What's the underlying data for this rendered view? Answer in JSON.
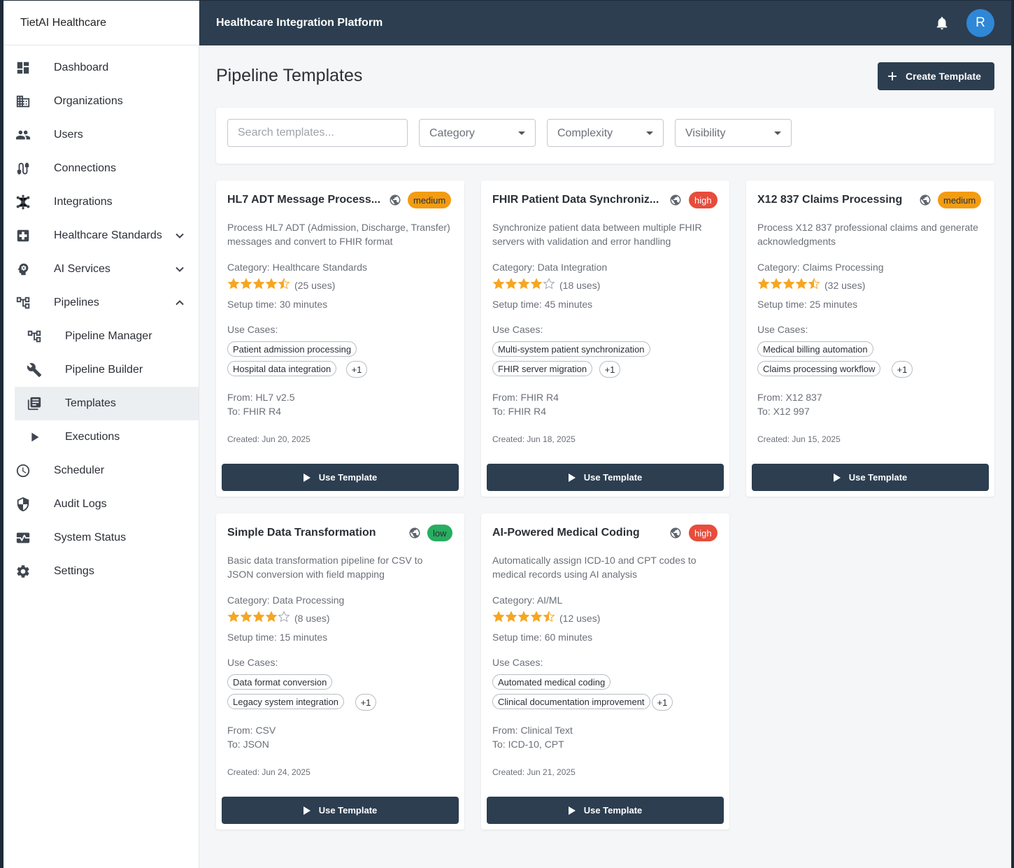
{
  "app": {
    "brand": "TietAI Healthcare",
    "topbar_title": "Healthcare Integration Platform",
    "avatar_initial": "R"
  },
  "sidebar": {
    "items": [
      {
        "label": "Dashboard",
        "icon": "dashboard-icon"
      },
      {
        "label": "Organizations",
        "icon": "building-icon"
      },
      {
        "label": "Users",
        "icon": "people-icon"
      },
      {
        "label": "Connections",
        "icon": "cable-icon"
      },
      {
        "label": "Integrations",
        "icon": "hub-icon"
      },
      {
        "label": "Healthcare Standards",
        "icon": "medical-plus-icon",
        "expanded": false
      },
      {
        "label": "AI Services",
        "icon": "brain-icon",
        "expanded": false
      },
      {
        "label": "Pipelines",
        "icon": "pipeline-icon",
        "expanded": true
      },
      {
        "label": "Pipeline Manager",
        "icon": "pipeline-icon",
        "sub": true
      },
      {
        "label": "Pipeline Builder",
        "icon": "wrench-icon",
        "sub": true
      },
      {
        "label": "Templates",
        "icon": "library-books-icon",
        "sub": true,
        "active": true
      },
      {
        "label": "Executions",
        "icon": "play-icon",
        "sub": true
      },
      {
        "label": "Scheduler",
        "icon": "clock-icon"
      },
      {
        "label": "Audit Logs",
        "icon": "shield-icon"
      },
      {
        "label": "System Status",
        "icon": "monitor-heart-icon"
      },
      {
        "label": "Settings",
        "icon": "gear-icon"
      }
    ]
  },
  "page": {
    "title": "Pipeline Templates",
    "create_label": "Create Template"
  },
  "filters": {
    "search_placeholder": "Search templates...",
    "category": "Category",
    "complexity": "Complexity",
    "visibility": "Visibility"
  },
  "colors": {
    "primary": "#2c3e50",
    "star": "#f5a623",
    "medium": "#f39c12",
    "high": "#e74c3c",
    "low": "#27ae60",
    "avatar": "#2f87d6"
  },
  "templates": [
    {
      "title": "HL7 ADT Message Process...",
      "complexity": "medium",
      "description": "Process HL7 ADT (Admission, Discharge, Transfer) messages and convert to FHIR format",
      "category": "Category: Healthcare Standards",
      "rating": 4.5,
      "uses": "(25 uses)",
      "setup": "Setup time: 30 minutes",
      "use_cases_label": "Use Cases:",
      "use_cases": [
        "Patient admission processing",
        "Hospital data integration"
      ],
      "more": "+1",
      "from": "From: HL7 v2.5",
      "to": "To: FHIR R4",
      "created": "Created: Jun 20, 2025",
      "button": "Use Template"
    },
    {
      "title": "FHIR Patient Data Synchroniz...",
      "complexity": "high",
      "description": "Synchronize patient data between multiple FHIR servers with validation and error handling",
      "category": "Category: Data Integration",
      "rating": 4,
      "uses": "(18 uses)",
      "setup": "Setup time: 45 minutes",
      "use_cases_label": "Use Cases:",
      "use_cases": [
        "Multi-system patient synchronization",
        "FHIR server migration"
      ],
      "more": "+1",
      "from": "From: FHIR R4",
      "to": "To: FHIR R4",
      "created": "Created: Jun 18, 2025",
      "button": "Use Template"
    },
    {
      "title": "X12 837 Claims Processing",
      "complexity": "medium",
      "description": "Process X12 837 professional claims and generate acknowledgments",
      "category": "Category: Claims Processing",
      "rating": 4.5,
      "uses": "(32 uses)",
      "setup": "Setup time: 25 minutes",
      "use_cases_label": "Use Cases:",
      "use_cases": [
        "Medical billing automation",
        "Claims processing workflow"
      ],
      "more": "+1",
      "from": "From: X12 837",
      "to": "To: X12 997",
      "created": "Created: Jun 15, 2025",
      "button": "Use Template"
    },
    {
      "title": "Simple Data Transformation",
      "complexity": "low",
      "description": "Basic data transformation pipeline for CSV to JSON conversion with field mapping",
      "category": "Category: Data Processing",
      "rating": 4,
      "uses": "(8 uses)",
      "setup": "Setup time: 15 minutes",
      "use_cases_label": "Use Cases:",
      "use_cases": [
        "Data format conversion",
        "Legacy system integration"
      ],
      "more": "+1",
      "from": "From: CSV",
      "to": "To: JSON",
      "created": "Created: Jun 24, 2025",
      "button": "Use Template"
    },
    {
      "title": "AI-Powered Medical Coding",
      "complexity": "high",
      "description": "Automatically assign ICD-10 and CPT codes to medical records using AI analysis",
      "category": "Category: AI/ML",
      "rating": 4.5,
      "uses": "(12 uses)",
      "setup": "Setup time: 60 minutes",
      "use_cases_label": "Use Cases:",
      "use_cases": [
        "Automated medical coding",
        "Clinical documentation improvement"
      ],
      "more": "+1",
      "from": "From: Clinical Text",
      "to": "To: ICD-10, CPT",
      "created": "Created: Jun 21, 2025",
      "button": "Use Template"
    }
  ]
}
